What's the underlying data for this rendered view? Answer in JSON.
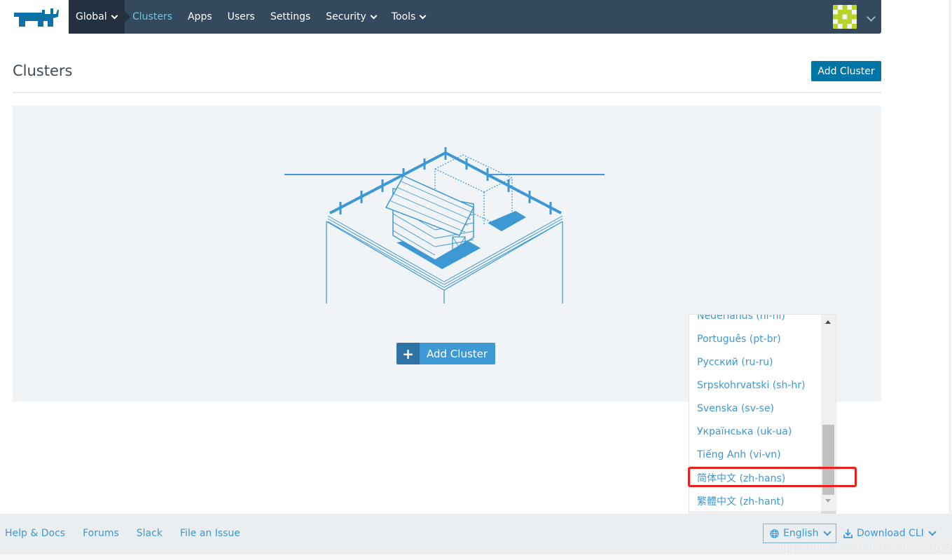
{
  "header": {
    "logo": "rancher-logo",
    "nav": {
      "global_label": "Global",
      "items": [
        {
          "label": "Clusters",
          "active": true,
          "dropdown": false
        },
        {
          "label": "Apps",
          "active": false,
          "dropdown": false
        },
        {
          "label": "Users",
          "active": false,
          "dropdown": false
        },
        {
          "label": "Settings",
          "active": false,
          "dropdown": false
        },
        {
          "label": "Security",
          "active": false,
          "dropdown": true
        },
        {
          "label": "Tools",
          "active": false,
          "dropdown": true
        }
      ]
    },
    "user_menu": {
      "avatar": "identicon-avatar",
      "icon": "chevron-down-icon"
    }
  },
  "page": {
    "title": "Clusters",
    "add_cluster_label": "Add Cluster"
  },
  "empty_state": {
    "illustration": "farm-barn-container-illustration",
    "add_cluster_label": "Add Cluster",
    "add_icon": "+"
  },
  "language_menu": {
    "items": [
      "Nederlands (nl-nl)",
      "Português (pt-br)",
      "Русский (ru-ru)",
      "Srpskohrvatski (sh-hr)",
      "Svenska (sv-se)",
      "Українська (uk-ua)",
      "Tiếng Anh (vi-vn)",
      "简体中文 (zh-hans)",
      "繁體中文 (zh-hant)"
    ],
    "highlighted": "简体中文 (zh-hans)"
  },
  "footer": {
    "links": [
      "Help & Docs",
      "Forums",
      "Slack",
      "File an Issue"
    ],
    "language_label": "English",
    "download_cli_label": "Download CLI"
  },
  "watermark": "https://blog.csdn.net/a1041646584",
  "colors": {
    "nav_bg": "#34485e",
    "nav_global_bg": "#22303f",
    "active_nav": "#6fc8d8",
    "primary": "#0075a8",
    "link": "#3d98d3",
    "highlight": "#f01d1d"
  }
}
